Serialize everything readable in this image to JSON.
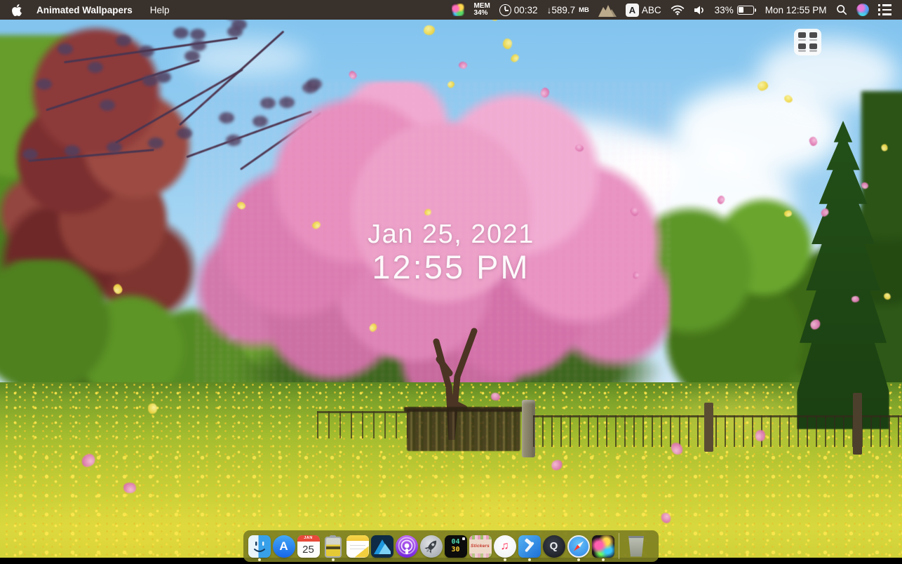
{
  "menubar": {
    "app_name": "Animated Wallpapers",
    "help_menu": "Help",
    "status": {
      "mem_label": "MEM",
      "mem_value": "34%",
      "timer": "00:32",
      "download": "↓589.7",
      "download_unit": "MB",
      "input_badge": "A",
      "input_label": "ABC",
      "battery_percent": "33%",
      "clock": "Mon 12:55 PM"
    }
  },
  "overlay": {
    "date": "Jan 25, 2021",
    "time": "12:55 PM"
  },
  "dock": {
    "calendar_month": "JAN",
    "calendar_day": "25",
    "appstore_letter": "A",
    "widget_top": "04",
    "widget_bottom": "30",
    "stickers_label": "Stickers",
    "quicktime_letter": "Q",
    "music_note": "♫"
  },
  "colors": {
    "menubar_bg": "#39312b",
    "dock_bg": "#7c7e21",
    "sky": "#8ec9ef",
    "blossom_pink": "#e388bb",
    "meadow_yellow": "#f6df3e",
    "overlay_text": "#ffffff"
  }
}
